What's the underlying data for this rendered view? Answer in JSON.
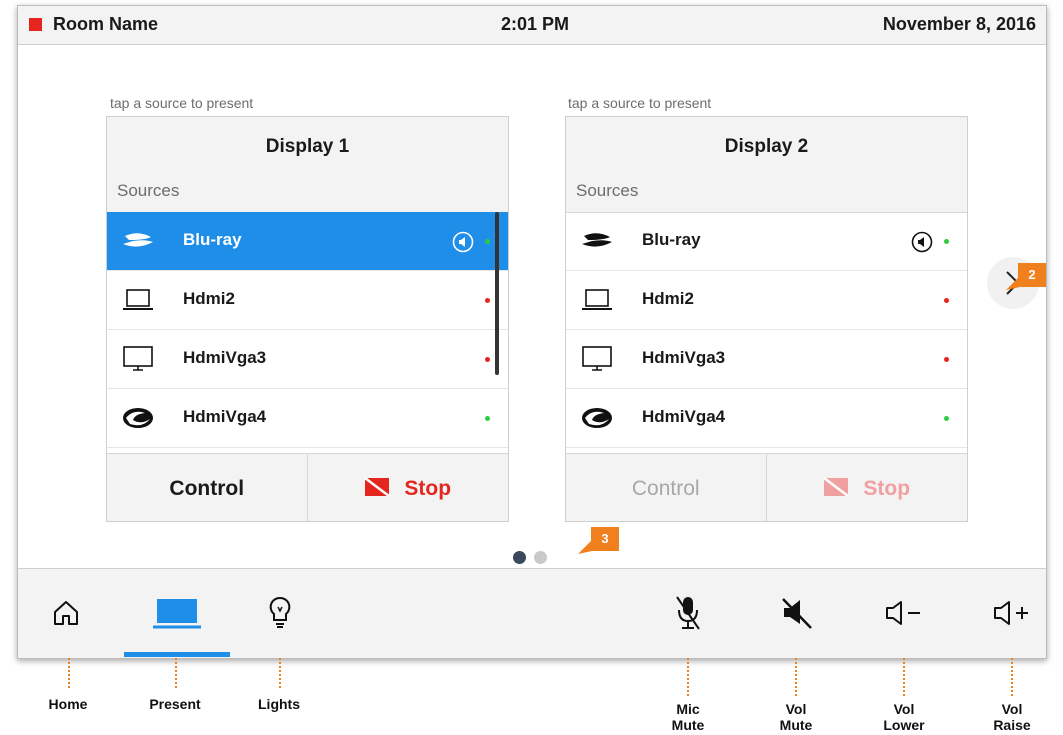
{
  "header": {
    "room_name": "Room Name",
    "time": "2:01 PM",
    "date": "November 8, 2016",
    "indicator_color": "#e4261f"
  },
  "displays": [
    {
      "hint": "tap a source to present",
      "title": "Display 1",
      "sources_label": "Sources",
      "sources": [
        {
          "label": "Blu-ray",
          "icon": "bluray-icon",
          "status": "green",
          "selected": true,
          "audio": true
        },
        {
          "label": "Hdmi2",
          "icon": "laptop-icon",
          "status": "red",
          "selected": false,
          "audio": false
        },
        {
          "label": "HdmiVga3",
          "icon": "monitor-icon",
          "status": "red",
          "selected": false,
          "audio": false
        },
        {
          "label": "HdmiVga4",
          "icon": "swirl-icon",
          "status": "green",
          "selected": false,
          "audio": false
        }
      ],
      "control_label": "Control",
      "stop_label": "Stop",
      "enabled": true
    },
    {
      "hint": "tap a source to present",
      "title": "Display 2",
      "sources_label": "Sources",
      "sources": [
        {
          "label": "Blu-ray",
          "icon": "bluray-icon",
          "status": "green",
          "selected": false,
          "audio": true
        },
        {
          "label": "Hdmi2",
          "icon": "laptop-icon",
          "status": "red",
          "selected": false,
          "audio": false
        },
        {
          "label": "HdmiVga3",
          "icon": "monitor-icon",
          "status": "red",
          "selected": false,
          "audio": false
        },
        {
          "label": "HdmiVga4",
          "icon": "swirl-icon",
          "status": "green",
          "selected": false,
          "audio": false
        }
      ],
      "control_label": "Control",
      "stop_label": "Stop",
      "enabled": false
    }
  ],
  "badges": {
    "next": "2",
    "pager": "3"
  },
  "pager": {
    "pages": 2,
    "current": 1
  },
  "bottom_nav": [
    {
      "key": "home",
      "icon": "home-icon",
      "annotation": "Home"
    },
    {
      "key": "present",
      "icon": "present-icon",
      "annotation": "Present",
      "active": true
    },
    {
      "key": "lights",
      "icon": "lightbulb-icon",
      "annotation": "Lights"
    },
    {
      "key": "mic-mute",
      "icon": "mic-mute-icon",
      "annotation": "Mic Mute"
    },
    {
      "key": "vol-mute",
      "icon": "speaker-mute-icon",
      "annotation": "Vol Mute"
    },
    {
      "key": "vol-lower",
      "icon": "volume-lower-icon",
      "annotation": "Vol Lower"
    },
    {
      "key": "vol-raise",
      "icon": "volume-raise-icon",
      "annotation": "Vol Raise"
    }
  ],
  "colors": {
    "accent": "#1f8ee8",
    "stop": "#e4261f",
    "status_green": "#2ecc40",
    "status_red": "#e4261f",
    "annotation": "#f07f1d"
  }
}
